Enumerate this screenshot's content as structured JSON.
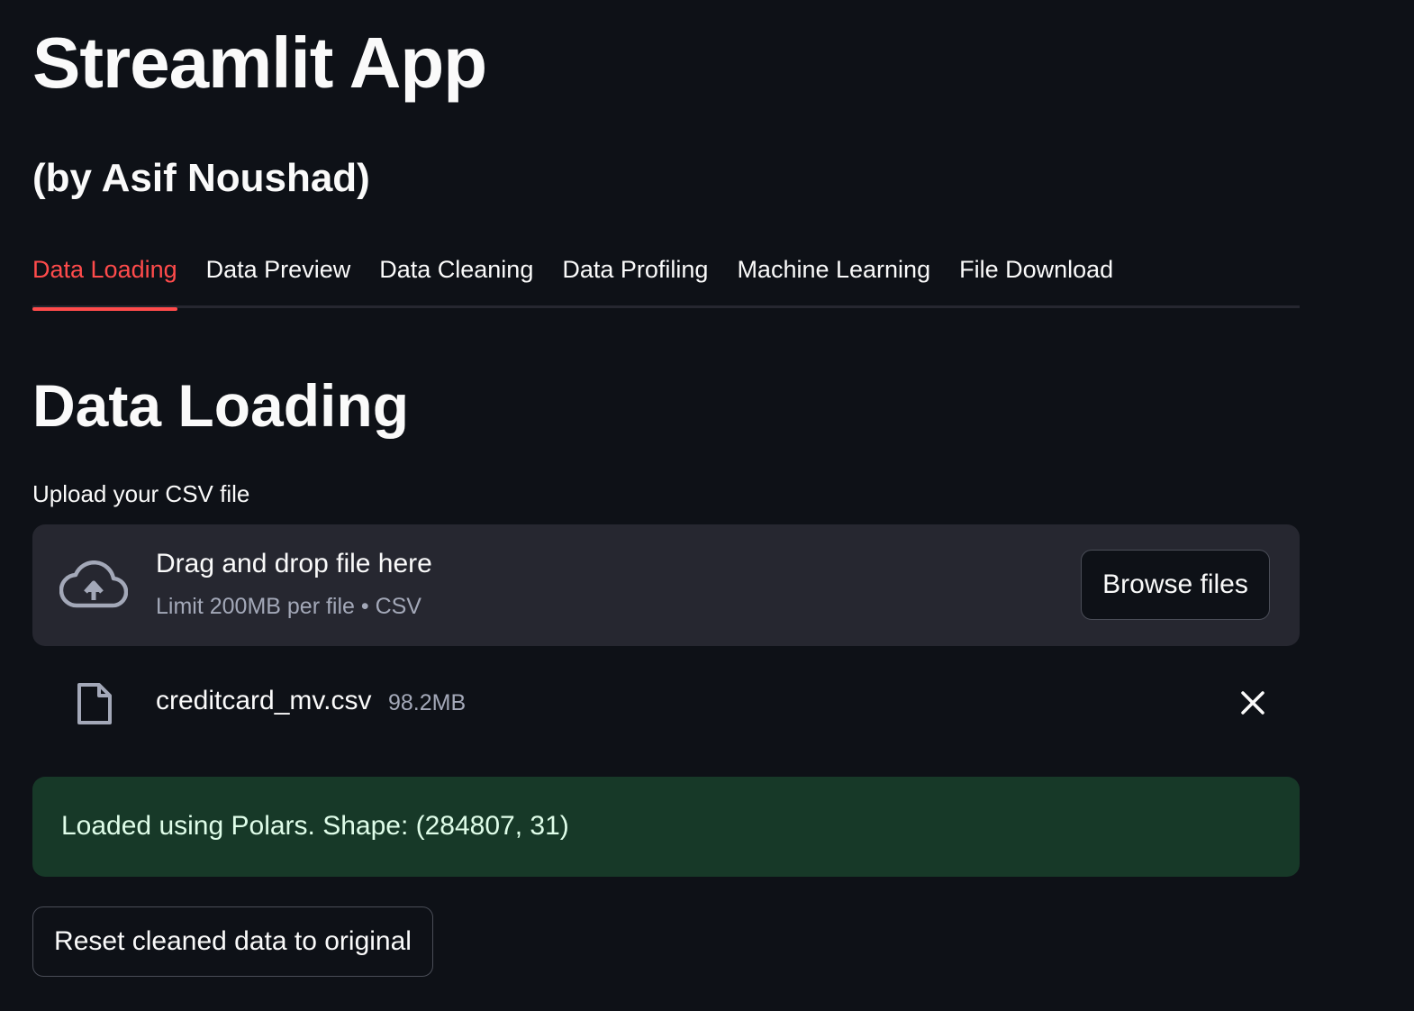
{
  "app": {
    "title": "Streamlit App",
    "subtitle": "(by Asif Noushad)"
  },
  "tabs": [
    {
      "label": "Data Loading",
      "active": true
    },
    {
      "label": "Data Preview",
      "active": false
    },
    {
      "label": "Data Cleaning",
      "active": false
    },
    {
      "label": "Data Profiling",
      "active": false
    },
    {
      "label": "Machine Learning",
      "active": false
    },
    {
      "label": "File Download",
      "active": false
    }
  ],
  "section": {
    "title": "Data Loading"
  },
  "uploader": {
    "label": "Upload your CSV file",
    "drop_text": "Drag and drop file here",
    "limit_text": "Limit 200MB per file • CSV",
    "browse_label": "Browse files",
    "icon": "cloud-upload-icon"
  },
  "uploaded_file": {
    "name": "creditcard_mv.csv",
    "size": "98.2MB",
    "icon": "file-icon",
    "remove_icon": "close-icon"
  },
  "status": {
    "message": "Loaded using Polars. Shape: (284807, 31)"
  },
  "actions": {
    "reset_label": "Reset cleaned data to original"
  },
  "colors": {
    "background": "#0e1117",
    "accent": "#ff4b4b",
    "surface": "#262730",
    "success_bg": "#173928",
    "success_text": "#dffde9",
    "muted_text": "#a3a8b8"
  }
}
